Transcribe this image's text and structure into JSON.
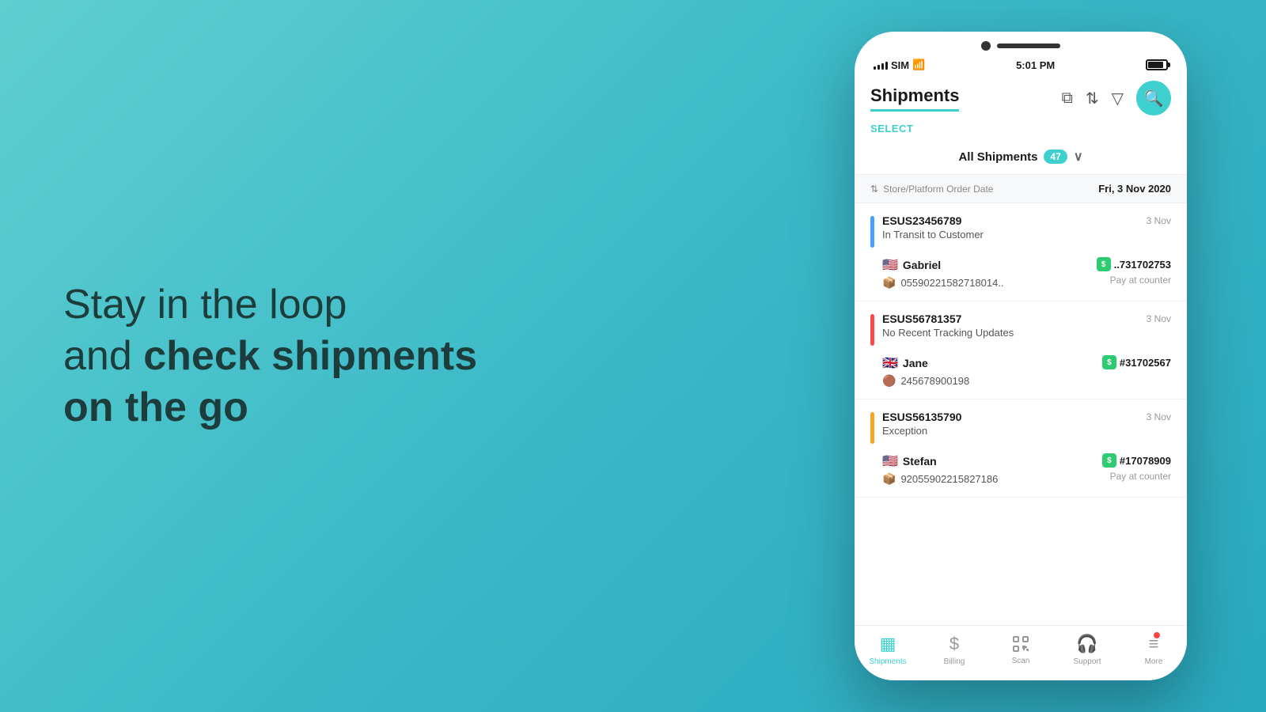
{
  "hero": {
    "line1": "Stay in the loop",
    "line2_regular": "and ",
    "line2_bold": "check shipments",
    "line3": "on the go"
  },
  "status_bar": {
    "carrier": "SIM",
    "time": "5:01 PM",
    "battery": "100%"
  },
  "app": {
    "title": "Shipments",
    "select_label": "SELECT",
    "filter": {
      "label": "All Shipments",
      "count": "47"
    },
    "date_section": {
      "sort_label": "Store/Platform Order Date",
      "date": "Fri, 3 Nov 2020"
    },
    "shipments": [
      {
        "id": "ESUS23456789",
        "status": "In Transit to Customer",
        "status_color": "blue",
        "date": "3 Nov",
        "customer_flag": "🇺🇸",
        "customer_name": "Gabriel",
        "order_id": "..731702753",
        "payment": "Pay at counter",
        "tracking": "05590221582718014..",
        "carrier": "📦"
      },
      {
        "id": "ESUS56781357",
        "status": "No Recent Tracking Updates",
        "status_color": "red",
        "date": "3 Nov",
        "customer_flag": "🇬🇧",
        "customer_name": "Jane",
        "order_id": "#31702567",
        "payment": "",
        "tracking": "245678900198",
        "carrier": "🟤"
      },
      {
        "id": "ESUS56135790",
        "status": "Exception",
        "status_color": "yellow",
        "date": "3 Nov",
        "customer_flag": "🇺🇸",
        "customer_name": "Stefan",
        "order_id": "#17078909",
        "payment": "Pay at counter",
        "tracking": "92055902215827186",
        "carrier": "📦"
      }
    ],
    "bottom_nav": [
      {
        "label": "Shipments",
        "icon": "▦",
        "active": true
      },
      {
        "label": "Billing",
        "icon": "$",
        "active": false
      },
      {
        "label": "Scan",
        "icon": "⬚",
        "active": false
      },
      {
        "label": "Support",
        "icon": "🎧",
        "active": false
      },
      {
        "label": "More",
        "icon": "≡",
        "active": false,
        "badge": true
      }
    ]
  }
}
